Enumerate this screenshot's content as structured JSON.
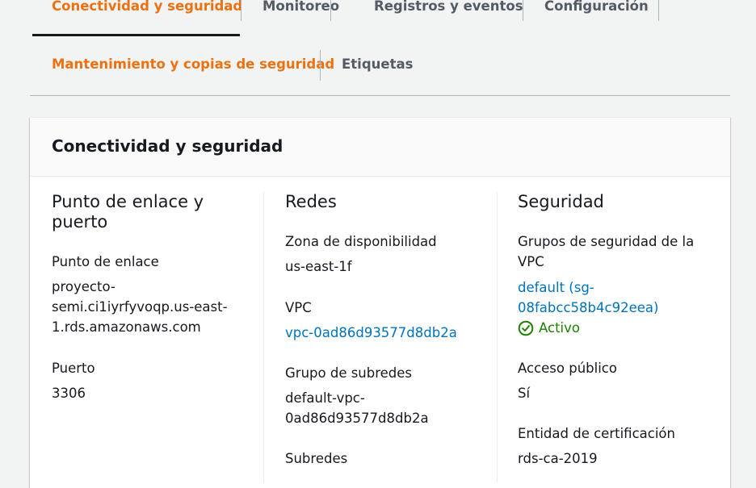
{
  "tabs": {
    "row1": [
      "Conectividad y seguridad",
      "Monitoreo",
      "Registros y eventos",
      "Configuración"
    ],
    "row2": [
      "Mantenimiento y copias de seguridad",
      "Etiquetas"
    ]
  },
  "panel": {
    "title": "Conectividad y seguridad",
    "endpoint": {
      "title_l1": "Punto de enlace y",
      "title_l2": "puerto",
      "endpoint_label": "Punto de enlace",
      "endpoint_l1": "proyecto-",
      "endpoint_l2": "semi.ci1iyrfyvoqp.us-east-",
      "endpoint_l3": "1.rds.amazonaws.com",
      "port_label": "Puerto",
      "port_value": "3306"
    },
    "network": {
      "title": "Redes",
      "az_label": "Zona de disponibilidad",
      "az_value": "us-east-1f",
      "vpc_label": "VPC",
      "vpc_value": "vpc-0ad86d93577d8db2a",
      "subnet_group_label": "Grupo de subredes",
      "subnet_group_l1": "default-vpc-",
      "subnet_group_l2": "0ad86d93577d8db2a",
      "subnets_label": "Subredes"
    },
    "security": {
      "title": "Seguridad",
      "sg_label_l1": "Grupos de seguridad de la",
      "sg_label_l2": "VPC",
      "sg_link_l1": "default (sg-",
      "sg_link_l2": "08fabcc58b4c92eea)",
      "sg_status": "Activo",
      "public_label": "Acceso público",
      "public_value": "Sí",
      "ca_label": "Entidad de certificación",
      "ca_value": "rds-ca-2019"
    }
  },
  "colors": {
    "accent": "#ec7211",
    "link": "#0073bb",
    "success": "#1d8102"
  },
  "icons": {
    "status": "check-circle-icon"
  }
}
